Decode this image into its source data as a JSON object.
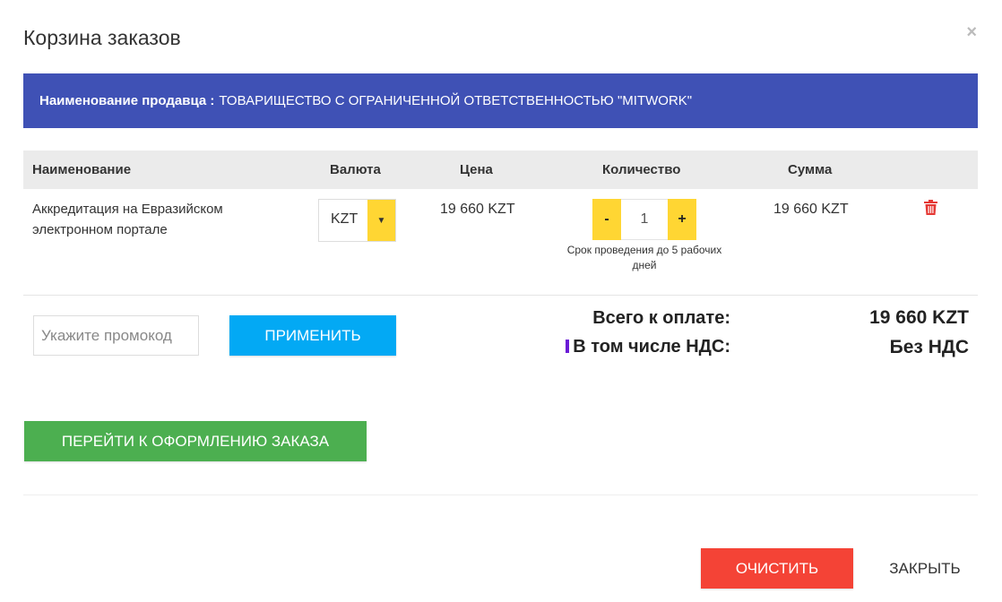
{
  "modal": {
    "title": "Корзина заказов",
    "close_icon": "×"
  },
  "seller": {
    "label": "Наименование продавца :",
    "name": "ТОВАРИЩЕСТВО С ОГРАНИЧЕННОЙ ОТВЕТСТВЕННОСТЬЮ \"MITWORK\""
  },
  "table": {
    "headers": {
      "name": "Наименование",
      "currency": "Валюта",
      "price": "Цена",
      "quantity": "Количество",
      "sum": "Сумма"
    },
    "rows": [
      {
        "name": "Аккредитация на Евразийском электронном портале",
        "currency": "KZT",
        "currency_arrow": "▼",
        "price": "19 660 KZT",
        "qty_minus": "-",
        "quantity": "1",
        "qty_plus": "+",
        "term_note": "Срок проведения до 5 рабочих дней",
        "sum": "19 660 KZT"
      }
    ]
  },
  "promo": {
    "placeholder": "Укажите промокод",
    "value": "",
    "apply_label": "ПРИМЕНИТЬ"
  },
  "totals": {
    "total_label": "Всего к оплате:",
    "total_value": "19 660 KZT",
    "vat_label": "В том числе НДС:",
    "vat_value": "Без НДС"
  },
  "actions": {
    "checkout_label": "ПЕРЕЙТИ К ОФОРМЛЕНИЮ ЗАКАЗА",
    "clear_label": "ОЧИСТИТЬ",
    "close_label": "ЗАКРЫТЬ"
  },
  "colors": {
    "seller_bar": "#3f51b5",
    "accent_yellow": "#ffd633",
    "apply_blue": "#03a9f4",
    "checkout_green": "#4caf50",
    "clear_red": "#f44336",
    "trash_red": "#e53935"
  }
}
